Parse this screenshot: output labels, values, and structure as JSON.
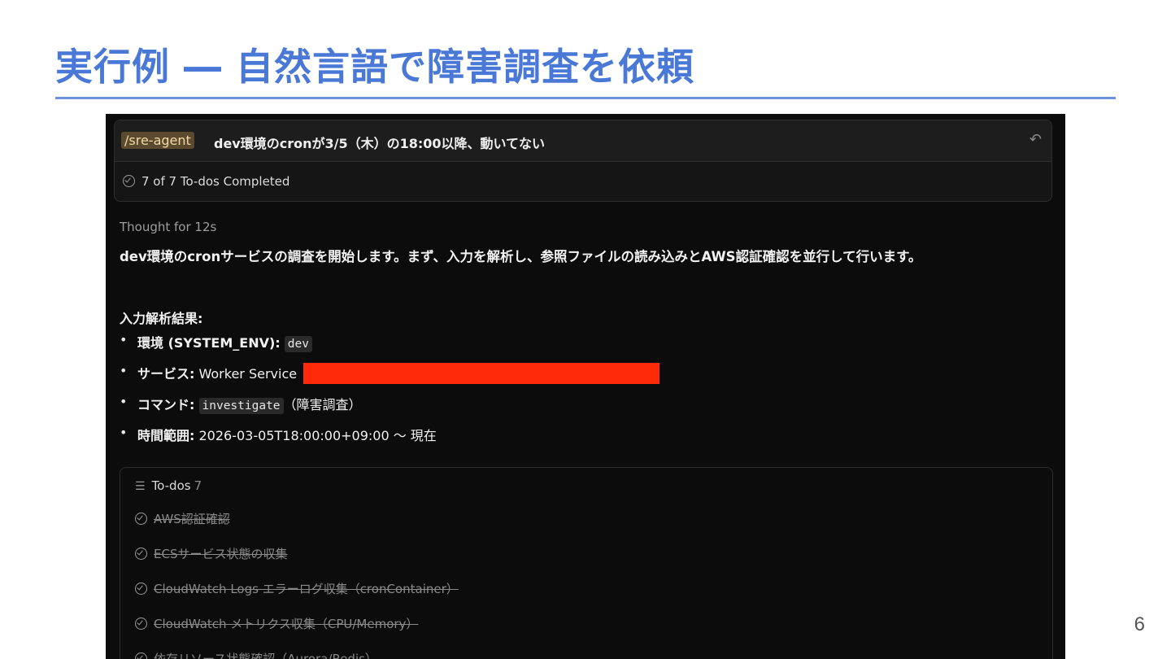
{
  "slide": {
    "title": "実行例 ― 自然言語で障害調査を依頼",
    "page_number": "6"
  },
  "prompt": {
    "command": "/sre-agent",
    "text": "dev環境のcronが3/5（木）の18:00以降、動いてない"
  },
  "todo_summary": "7 of 7 To-dos Completed",
  "thought": "Thought for 12s",
  "paragraph": "dev環境のcronサービスの調査を開始します。まず、入力を解析し、参照ファイルの読み込みとAWS認証確認を並行して行います。",
  "parse_heading": "入力解析結果:",
  "bullets": [
    {
      "label": "環境 (SYSTEM_ENV):",
      "code": "dev",
      "suffix": ""
    },
    {
      "label": "サービス:",
      "code": "",
      "suffix": "Worker Service"
    },
    {
      "label": "コマンド:",
      "code": "investigate",
      "suffix": "（障害調査）"
    },
    {
      "label": "時間範囲:",
      "code": "",
      "suffix": "2026-03-05T18:00:00+09:00 〜 現在"
    }
  ],
  "todos": {
    "title": "To-dos",
    "count": "7",
    "items": [
      "AWS認証確認",
      "ECSサービス状態の収集",
      "CloudWatch Logs エラーログ収集（cronContainer）",
      "CloudWatch メトリクス収集（CPU/Memory）",
      "依存リソース状態確認（Aurora/Redis）"
    ]
  },
  "colors": {
    "title_blue": "#4a78d6",
    "terminal_bg": "#0c0c0c",
    "redaction": "#ff2a0a"
  }
}
